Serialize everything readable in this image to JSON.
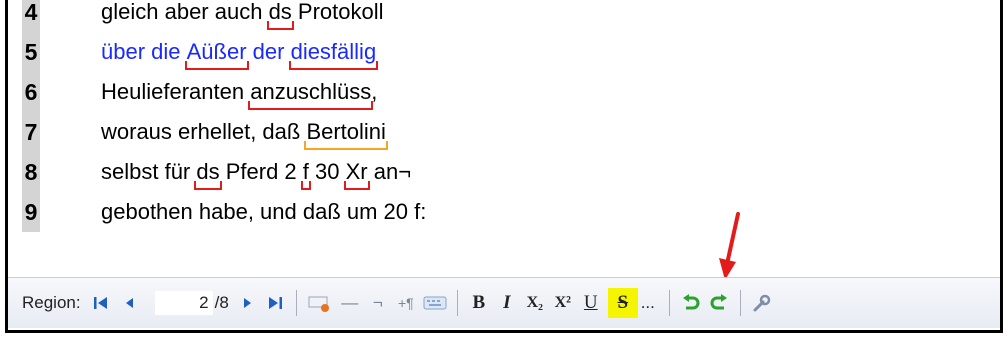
{
  "lines": [
    {
      "number": "4",
      "text": "gleich aber auch ds Protokoll",
      "color": "#000000"
    },
    {
      "number": "5",
      "text": "über die Aüßer der diesfällig",
      "color": "#1a2aff"
    },
    {
      "number": "6",
      "text": "Heulieferanten anzuschlüss,",
      "color": "#000000"
    },
    {
      "number": "7",
      "text": "woraus erhellet, daß Bertolini",
      "color": "#000000"
    },
    {
      "number": "8",
      "text": "selbst für ds Pferd 2 f 30 Xr an¬",
      "color": "#000000"
    },
    {
      "number": "9",
      "text": "gebothen habe, und daß um 20 f:",
      "color": "#000000"
    }
  ],
  "toolbar": {
    "region_label": "Region:",
    "page_value": "2",
    "page_total": "/8",
    "first_icon": "first-page-icon",
    "prev_icon": "previous-page-icon",
    "next_icon": "next-page-icon",
    "last_icon": "last-page-icon",
    "bold": "B",
    "italic": "I",
    "subscript": "X₂",
    "superscript": "X²",
    "underline": "U",
    "strike": "S",
    "more": "...",
    "dash": "—",
    "neg": "¬",
    "plus_para": "+¶"
  },
  "colors": {
    "underline_error": "#e21b1b",
    "underline_warning": "#f5a623",
    "arrow": "#e21b1b",
    "highlight": "#f5f500"
  }
}
